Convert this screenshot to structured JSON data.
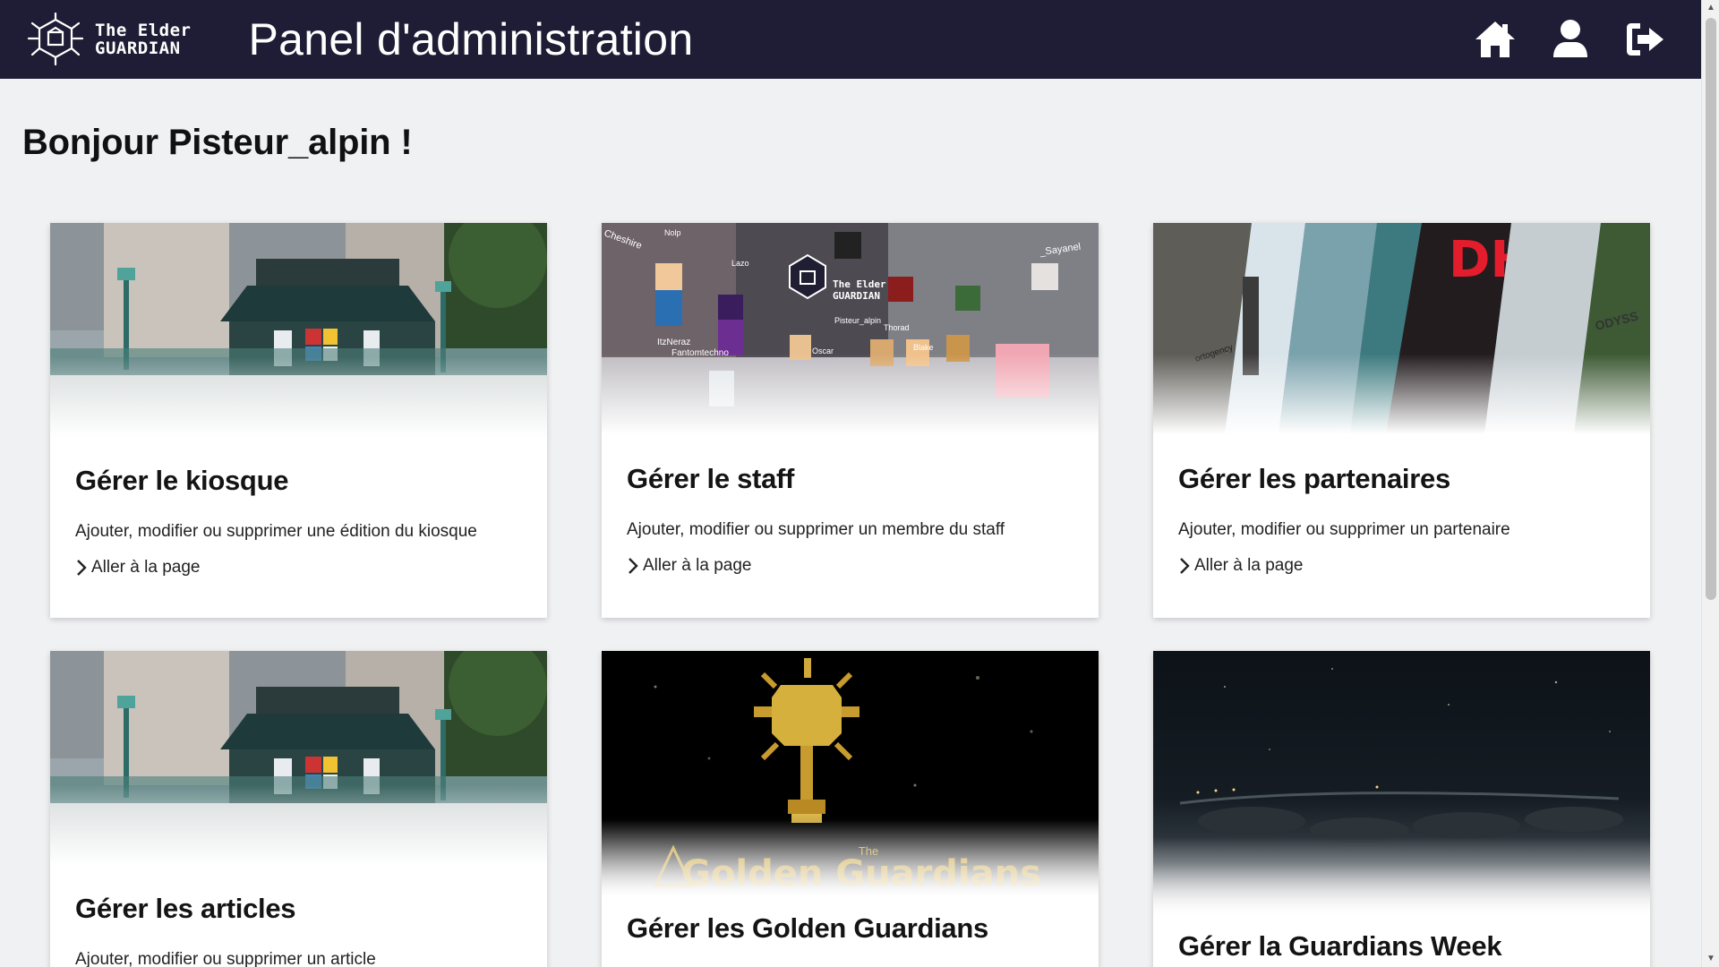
{
  "header": {
    "logo_line1": "The Elder",
    "logo_line2": "GUARDIAN",
    "title": "Panel d'administration",
    "icons": [
      "home-icon",
      "user-icon",
      "logout-icon"
    ]
  },
  "greeting": "Bonjour Pisteur_alpin !",
  "colors": {
    "header_bg": "#1e1d35",
    "page_bg": "#f0f1f2",
    "card_bg": "#ffffff"
  },
  "cards": [
    {
      "title": "Gérer le kiosque",
      "description": "Ajouter, modifier ou supprimer une édition du kiosque",
      "link": "Aller à la page"
    },
    {
      "title": "Gérer le staff",
      "description": "Ajouter, modifier ou supprimer un membre du staff",
      "link": "Aller à la page",
      "image_text": {
        "logo_line1": "The Elder",
        "logo_line2": "GUARDIAN",
        "names": [
          "Cheshire",
          "Nolp",
          "Lazo",
          "Pisteur_alpin",
          "_Sayanel",
          "Fantomtechno",
          "ItzNeraz",
          "Oscar",
          "Blake",
          "Thorad"
        ]
      }
    },
    {
      "title": "Gérer les partenaires",
      "description": "Ajouter, modifier ou supprimer un partenaire",
      "link": "Aller à la page",
      "image_text": {
        "sign1": "DH",
        "sign2": "ODYSS",
        "sign3": "ortogency"
      }
    },
    {
      "title": "Gérer les articles",
      "description": "Ajouter, modifier ou supprimer un article"
    },
    {
      "title": "Gérer les Golden Guardians",
      "image_text": {
        "small": "The",
        "big": "Golden Guardians"
      }
    },
    {
      "title": "Gérer la Guardians Week"
    }
  ]
}
